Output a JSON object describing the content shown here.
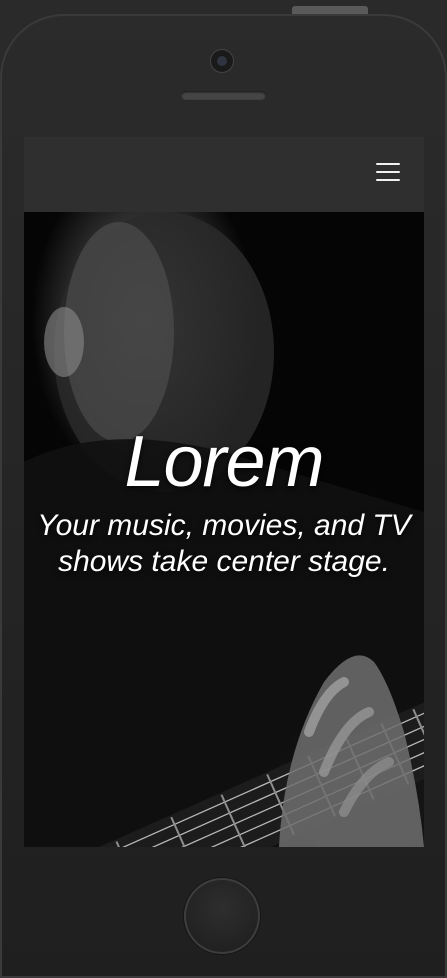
{
  "device": {
    "type": "smartphone",
    "icons": [
      "camera-icon",
      "speaker-grille",
      "home-button"
    ]
  },
  "navbar": {
    "menu_icon": "hamburger-menu-icon"
  },
  "hero": {
    "title": "Lorem",
    "subtitle": "Your music, movies, and TV shows take center stage.",
    "image_description": "black-and-white photo of a man playing guitar"
  },
  "colors": {
    "navbar_bg": "#2f2f2f",
    "hero_text": "#ffffff",
    "phone_body": "#252525"
  }
}
